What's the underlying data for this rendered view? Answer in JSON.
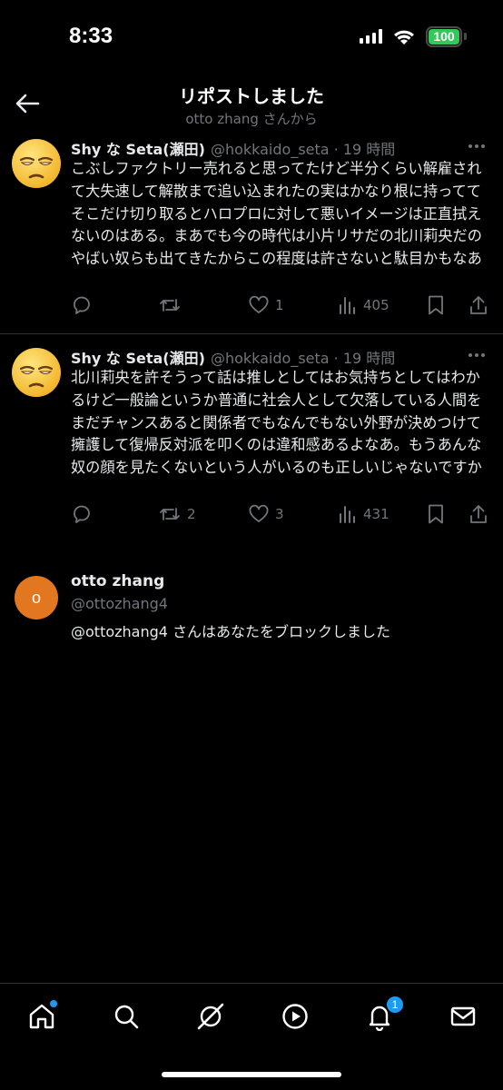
{
  "status": {
    "time": "8:33",
    "battery": "100"
  },
  "header": {
    "title": "リポストしました",
    "subtitle": "otto zhang さんから"
  },
  "posts": [
    {
      "name": "Shy な Seta(瀬田)",
      "handle": "@hokkaido_seta",
      "time": "· 19 時間",
      "text": "こぶしファクトリー売れると思ってたけど半分くらい解雇されて大失速して解散まで追い込まれたの実はかなり根に持っててそこだけ切り取るとハロプロに対して悪いイメージは正直拭えないのはある。まあでも今の時代は小片リサだの北川莉央だのやばい奴らも出てきたからこの程度は許さないと駄目かもなあ",
      "replies": "",
      "reposts": "",
      "likes": "1",
      "views": "405"
    },
    {
      "name": "Shy な Seta(瀬田)",
      "handle": "@hokkaido_seta",
      "time": "· 19 時間",
      "text": "北川莉央を許そうって話は推しとしてはお気持ちとしてはわかるけど一般論というか普通に社会人として欠落している人間をまだチャンスあると関係者でもなんでもない外野が決めつけて擁護して復帰反対派を叩くのは違和感あるよなあ。もうあんな奴の顔を見たくないという人がいるのも正しいじゃないですか",
      "replies": "",
      "reposts": "2",
      "likes": "3",
      "views": "431"
    }
  ],
  "blocked": {
    "avatar_letter": "o",
    "name": "otto zhang",
    "handle": "@ottozhang4",
    "message": "@ottozhang4 さんはあなたをブロックしました"
  },
  "tabbar": {
    "items": [
      "home-icon",
      "search-icon",
      "grok-icon",
      "video-icon",
      "notifications-icon",
      "messages-icon"
    ],
    "notifications_badge": "1"
  },
  "colors": {
    "background": "#000000",
    "text": "#e7e9ea",
    "muted": "#71767b",
    "accent": "#1d9bf0",
    "avatar": "#e37720",
    "battery": "#34c759"
  }
}
